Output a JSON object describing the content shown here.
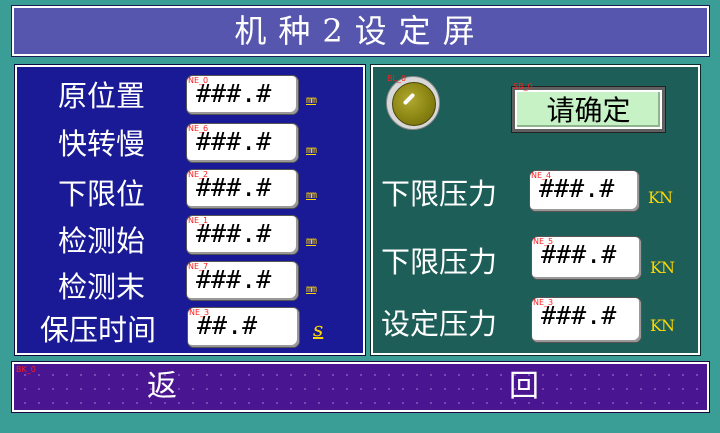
{
  "title": "机种2设定屏",
  "left_rows": [
    {
      "label": "原位置",
      "tag": "NE_0",
      "value": "###.#",
      "unit": "mm"
    },
    {
      "label": "快转慢",
      "tag": "NE_6",
      "value": "###.#",
      "unit": "mm"
    },
    {
      "label": "下限位",
      "tag": "NE_2",
      "value": "###.#",
      "unit": "mm"
    },
    {
      "label": "检测始",
      "tag": "NE_1",
      "value": "###.#",
      "unit": "mm"
    },
    {
      "label": "检测末",
      "tag": "NE_7",
      "value": "###.#",
      "unit": "mm"
    },
    {
      "label": "保压时间",
      "tag": "NE_3",
      "value": "##.#",
      "unit": "s"
    }
  ],
  "lamp": {
    "tag": "BL_0",
    "color": "#8a8412"
  },
  "confirm": {
    "tag": "SB_0",
    "label": "请确定",
    "color": "#c6f2c6"
  },
  "right_rows": [
    {
      "label": "下限压力",
      "tag": "NE_4",
      "value": "###.#",
      "unit": "KN"
    },
    {
      "label": "下限压力",
      "tag": "NE_5",
      "value": "###.#",
      "unit": "KN"
    },
    {
      "label": "设定压力",
      "tag": "NE_3",
      "value": "###.#",
      "unit": "KN"
    }
  ],
  "return_button": {
    "tag": "BK_0",
    "label_left": "返",
    "label_right": "回"
  },
  "colors": {
    "background": "#3a9e96",
    "title": "#5656ae",
    "left_panel": "#1a1a96",
    "right_panel": "#1d5e58",
    "return_bar": "#4a1590",
    "unit": "#ffd700"
  }
}
